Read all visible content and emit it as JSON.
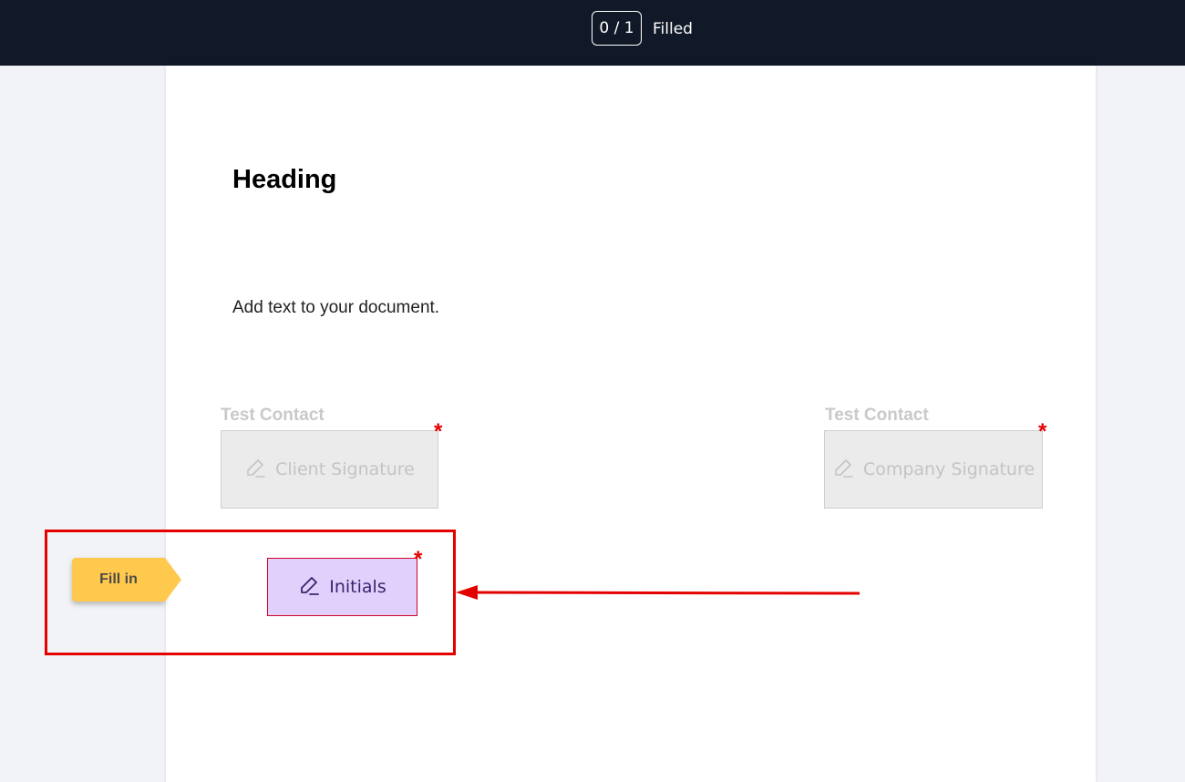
{
  "header": {
    "counter": "0 / 1",
    "filled_label": "Filled"
  },
  "document": {
    "heading": "Heading",
    "body_text": "Add text to your document."
  },
  "fields": {
    "client": {
      "contact_label": "Test Contact",
      "label": "Client Signature",
      "required_mark": "*",
      "icon": "pen-icon"
    },
    "company": {
      "contact_label": "Test Contact",
      "label": "Company Signature",
      "required_mark": "*",
      "icon": "pen-icon"
    },
    "initials": {
      "label": "Initials",
      "required_mark": "*",
      "icon": "pen-icon"
    }
  },
  "guide": {
    "fill_in_label": "Fill in"
  },
  "colors": {
    "topbar": "#111827",
    "initials_bg": "#e1d0fb",
    "fill_in_bg": "#ffc94d",
    "annotation": "#e50000"
  }
}
